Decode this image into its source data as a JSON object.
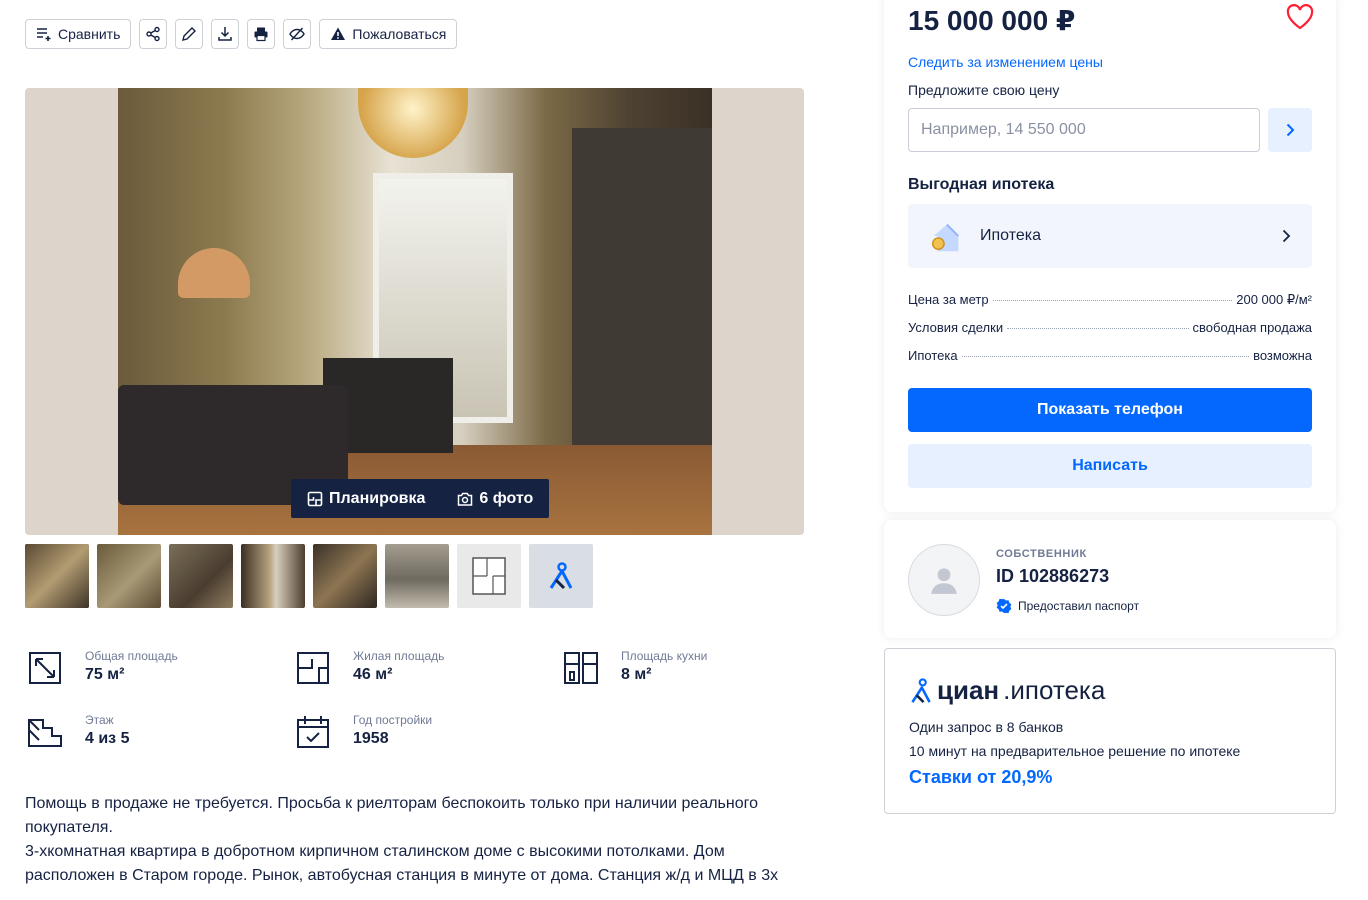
{
  "toolbar": {
    "compare_label": "Сравнить",
    "complain_label": "Пожаловаться",
    "icons": [
      "share-icon",
      "edit-icon",
      "download-icon",
      "print-icon",
      "hide-icon"
    ]
  },
  "gallery": {
    "plan_label": "Планировка",
    "photos_label": "6 фото",
    "thumb_count": 8
  },
  "facts": [
    {
      "label": "Общая площадь",
      "value": "75 м²"
    },
    {
      "label": "Жилая площадь",
      "value": "46 м²"
    },
    {
      "label": "Площадь кухни",
      "value": "8 м²"
    },
    {
      "label": "Этаж",
      "value": "4 из 5"
    },
    {
      "label": "Год постройки",
      "value": "1958"
    }
  ],
  "description": {
    "line1": "Помощь в продаже не требуется. Просьба к риелторам беспокоить только при наличии реального",
    "line2": "покупателя.",
    "line3": "3-хкомнатная квартира в добротном кирпичном сталинском доме с высокими потолками.  Дом",
    "line4": "расположен в Старом городе. Рынок, автобусная станция в минуте от дома.  Станция ж/д и МЦД в 3х"
  },
  "offer": {
    "price": "15 000 000 ₽",
    "follow_link": "Следить за изменением цены",
    "suggest_label": "Предложите свою цену",
    "suggest_placeholder": "Например, 14 550 000",
    "mortgage_title": "Выгодная ипотека",
    "mortgage_banner": "Ипотека",
    "rows": [
      {
        "k": "Цена за метр",
        "v": "200 000 ₽/м²"
      },
      {
        "k": "Условия сделки",
        "v": "свободная продажа"
      },
      {
        "k": "Ипотека",
        "v": "возможна"
      }
    ],
    "show_phone": "Показать телефон",
    "write": "Написать"
  },
  "owner": {
    "role": "СОБСТВЕННИК",
    "id": "ID 102886273",
    "verified": "Предоставил паспорт"
  },
  "promo": {
    "logo_main": "циан",
    "logo_sub": ".ипотека",
    "line1": "Один запрос в 8 банков",
    "line2": "10 минут на предварительное решение по ипотеке",
    "rate": "Ставки от 20,9%"
  },
  "colors": {
    "accent": "#0468ff",
    "text": "#152242",
    "heart": "#ff1f34"
  }
}
